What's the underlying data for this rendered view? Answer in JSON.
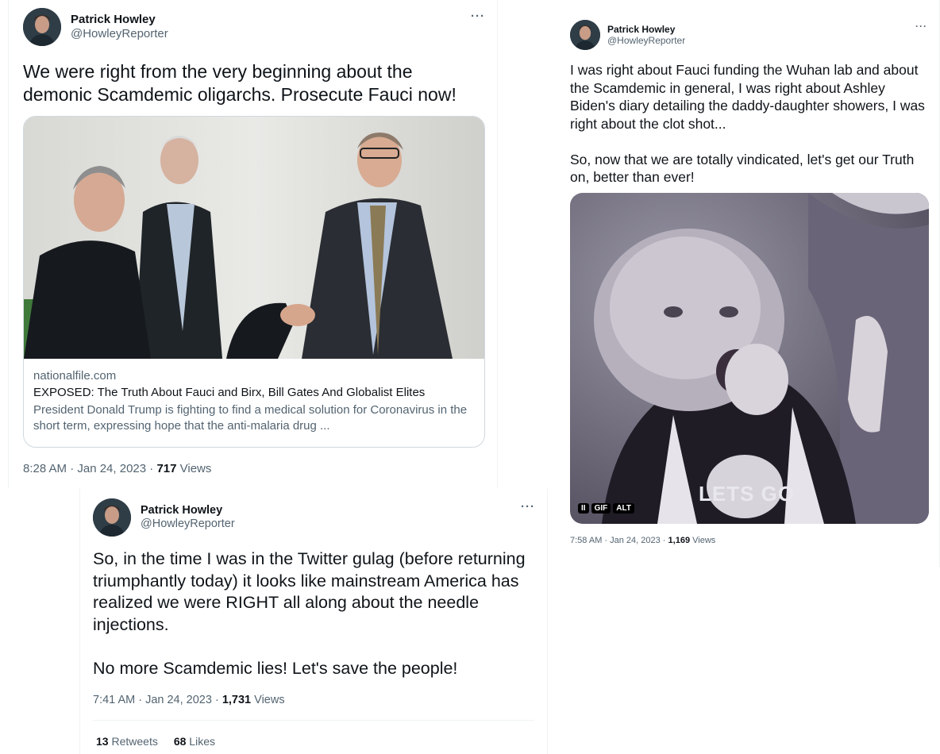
{
  "tweet1": {
    "display_name": "Patrick Howley",
    "handle": "@HowleyReporter",
    "more": "···",
    "text": "We were right from the very beginning about the demonic Scamdemic oligarchs. Prosecute Fauci now!",
    "link": {
      "domain": "nationalfile.com",
      "title": "EXPOSED: The Truth About Fauci and Birx, Bill Gates And Globalist Elites",
      "description": "President Donald Trump is fighting to find a medical solution for Coronavirus in the short term, expressing hope that the anti-malaria drug ..."
    },
    "time": "8:28 AM · Jan 24, 2023 · ",
    "views_count": "717",
    "views_label": "Views"
  },
  "tweet2": {
    "display_name": "Patrick Howley",
    "handle": "@HowleyReporter",
    "more": "···",
    "text": "I was right about Fauci funding the Wuhan lab and about the Scamdemic in general, I was right about Ashley Biden's diary detailing the daddy-daughter showers, I was right about the clot shot...\n\nSo, now that we are totally vindicated, let's get our Truth on, better than ever!",
    "gif": {
      "pause": "II",
      "gif_badge": "GIF",
      "alt_badge": "ALT",
      "overlay": "LETS GO"
    },
    "time": "7:58 AM · Jan 24, 2023 · ",
    "views_count": "1,169",
    "views_label": "Views"
  },
  "tweet3": {
    "display_name": "Patrick Howley",
    "handle": "@HowleyReporter",
    "more": "···",
    "text": "So, in the time I was in the Twitter gulag (before returning triumphantly today) it looks like mainstream America has realized we were RIGHT all along about the needle injections.\n\nNo more Scamdemic lies! Let's save the people!",
    "time": "7:41 AM · Jan 24, 2023 · ",
    "views_count": "1,731",
    "views_label": "Views",
    "retweets_count": "13",
    "retweets_label": "Retweets",
    "likes_count": "68",
    "likes_label": "Likes"
  }
}
